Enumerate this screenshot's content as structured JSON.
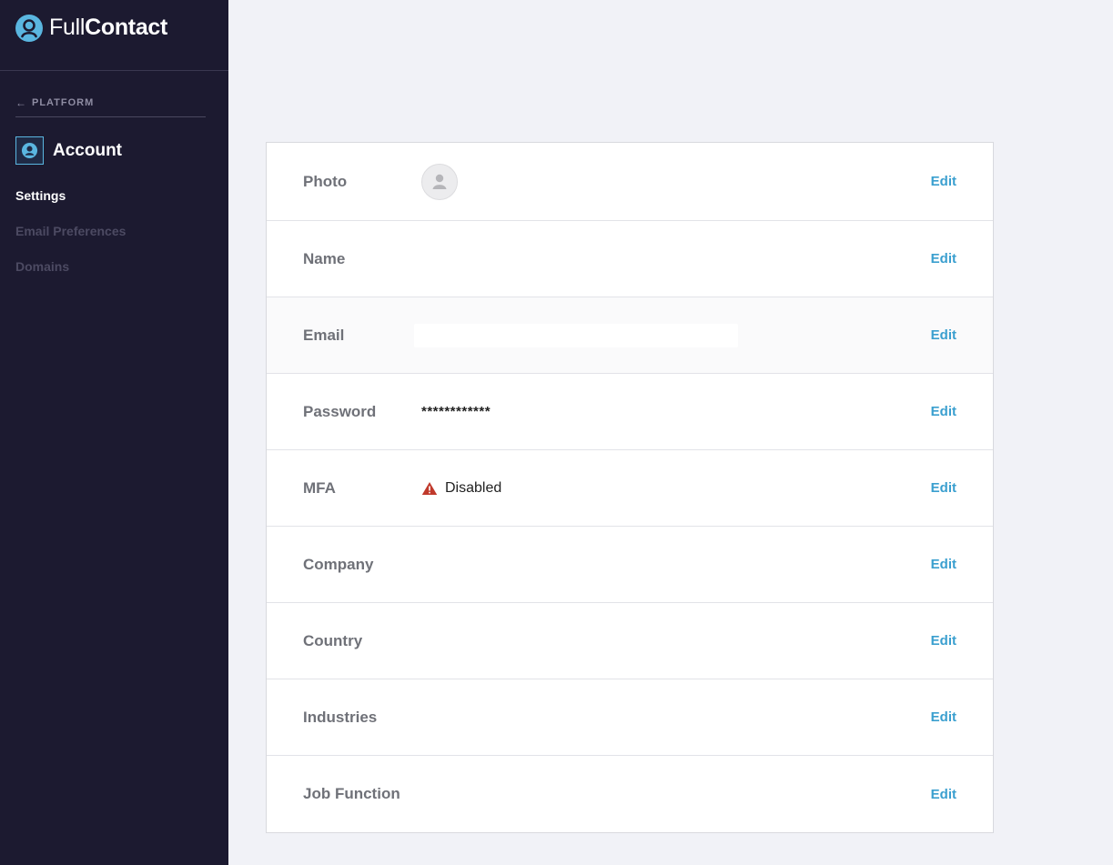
{
  "brand": {
    "name_light": "Full",
    "name_bold": "Contact"
  },
  "sidebar": {
    "back_label": "PLATFORM",
    "section_title": "Account",
    "items": [
      {
        "label": "Settings",
        "active": true
      },
      {
        "label": "Email Preferences",
        "active": false
      },
      {
        "label": "Domains",
        "active": false
      }
    ]
  },
  "settings": {
    "edit_label": "Edit",
    "rows": [
      {
        "label": "Photo"
      },
      {
        "label": "Name",
        "value": ""
      },
      {
        "label": "Email",
        "value": ""
      },
      {
        "label": "Password",
        "value": "************"
      },
      {
        "label": "MFA",
        "value": "Disabled",
        "status_color": "#c0392b"
      },
      {
        "label": "Company",
        "value": ""
      },
      {
        "label": "Country",
        "value": ""
      },
      {
        "label": "Industries",
        "value": ""
      },
      {
        "label": "Job Function",
        "value": ""
      }
    ]
  },
  "colors": {
    "sidebar_bg": "#1c1a30",
    "accent": "#3a9fcf",
    "warning": "#c0392b"
  },
  "icons": [
    "fullcontact-logo-icon",
    "arrow-left-icon",
    "account-icon",
    "avatar-placeholder-icon",
    "warning-icon"
  ]
}
